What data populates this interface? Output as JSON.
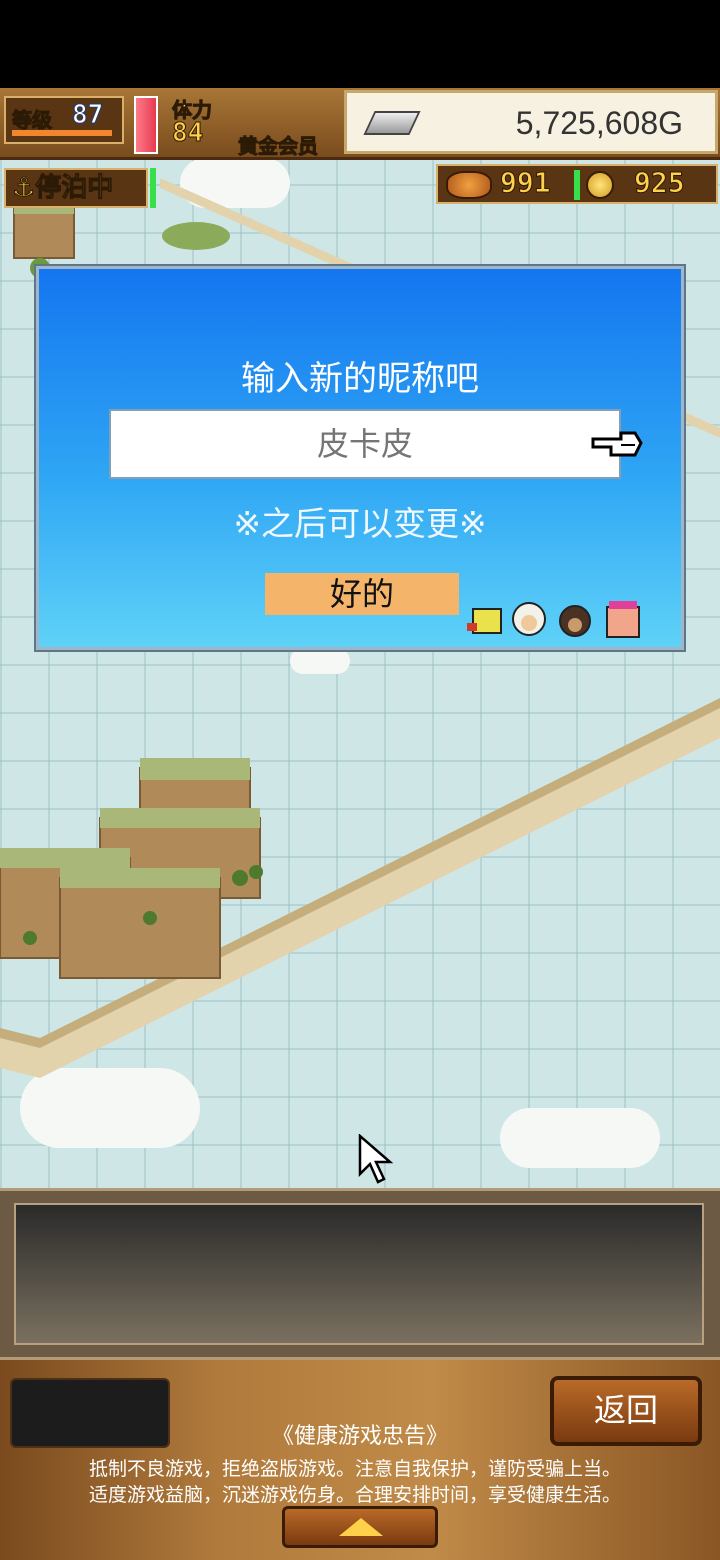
{
  "hud": {
    "level_label": "等级",
    "level_value": "87",
    "stamina_label": "体力",
    "stamina_value": "84",
    "membership": "黄金会员",
    "gold": "5,725,608G",
    "status": "⚓停泊中",
    "food_count": "991",
    "medal_count": "925"
  },
  "dialog": {
    "title": "输入新的昵称吧",
    "input_placeholder": "皮卡皮",
    "note": "※之后可以变更※",
    "ok_label": "好的"
  },
  "footer": {
    "back_label": "返回",
    "advice_title": "《健康游戏忠告》",
    "advice_line1": "抵制不良游戏，拒绝盗版游戏。注意自我保护，谨防受骗上当。",
    "advice_line2": "适度游戏益脑，沉迷游戏伤身。合理安排时间，享受健康生活。"
  },
  "icons": [
    "silver-bar-icon",
    "food-icon",
    "medal-icon",
    "pointing-hand-icon",
    "mouse-cursor-icon",
    "expand-up-icon"
  ],
  "colors": {
    "dialog_top": "#1476f0",
    "dialog_bottom": "#5fd2f8",
    "ok_button": "#f4b46a",
    "hud_text": "#ffd14a"
  }
}
